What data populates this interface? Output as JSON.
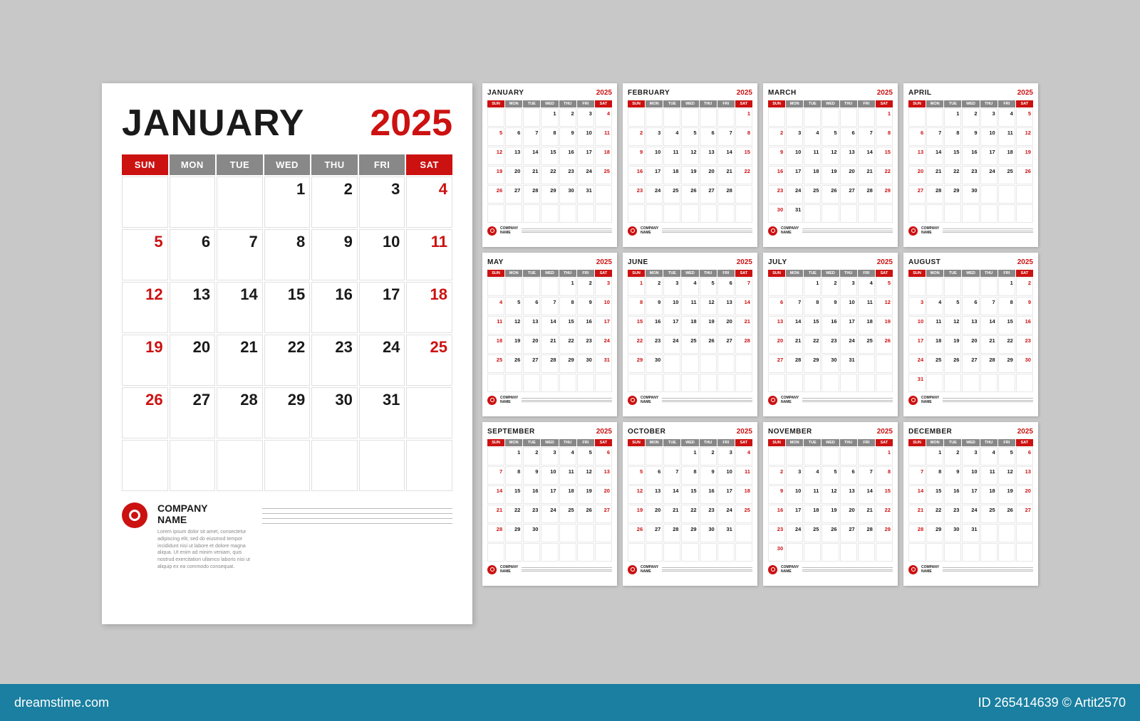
{
  "year": "2025",
  "brand": {
    "site": "dreamstime.com",
    "id": "265414639",
    "author": "© Artit2570"
  },
  "company": {
    "name": "COMPANY\nNAME",
    "desc": "Lorem ipsum dolor sit amet, consectetur adipiscing elit, sed do eiusmod tempor incididunt nisi ut labore et dolore magna aliqua. Ut enim ad minim veniam, quis nostrud exercitation ullamco laboris nisi ut aliquip ex ea commodo consequat."
  },
  "dayHeaders": [
    "SUN",
    "MON",
    "TUE",
    "WED",
    "THU",
    "FRI",
    "SAT"
  ],
  "months": [
    {
      "name": "JANUARY",
      "short": "JANUARY",
      "year": "2025",
      "startDay": 3,
      "days": 31
    },
    {
      "name": "FEBRUARY",
      "short": "FEBRUARY",
      "year": "2025",
      "startDay": 6,
      "days": 28
    },
    {
      "name": "MARCH",
      "short": "MARCH",
      "year": "2025",
      "startDay": 6,
      "days": 31
    },
    {
      "name": "APRIL",
      "short": "APRIL",
      "year": "2025",
      "startDay": 2,
      "days": 30
    },
    {
      "name": "MAY",
      "short": "MAY",
      "year": "2025",
      "startDay": 4,
      "days": 31
    },
    {
      "name": "JUNE",
      "short": "JUNE",
      "year": "2025",
      "startDay": 0,
      "days": 30
    },
    {
      "name": "JULY",
      "short": "JULY",
      "year": "2025",
      "startDay": 2,
      "days": 31
    },
    {
      "name": "AUGUST",
      "short": "AUGUST",
      "year": "2025",
      "startDay": 5,
      "days": 31
    },
    {
      "name": "SEPTEMBER",
      "short": "SEPTEMBER",
      "year": "2025",
      "startDay": 1,
      "days": 30
    },
    {
      "name": "OCTOBER",
      "short": "OCTOBER",
      "year": "2025",
      "startDay": 3,
      "days": 31
    },
    {
      "name": "NOVEMBER",
      "short": "NOVEMBER",
      "year": "2025",
      "startDay": 6,
      "days": 30
    },
    {
      "name": "DECEMBER",
      "short": "DECEMBER",
      "year": "2025",
      "startDay": 1,
      "days": 31
    }
  ]
}
